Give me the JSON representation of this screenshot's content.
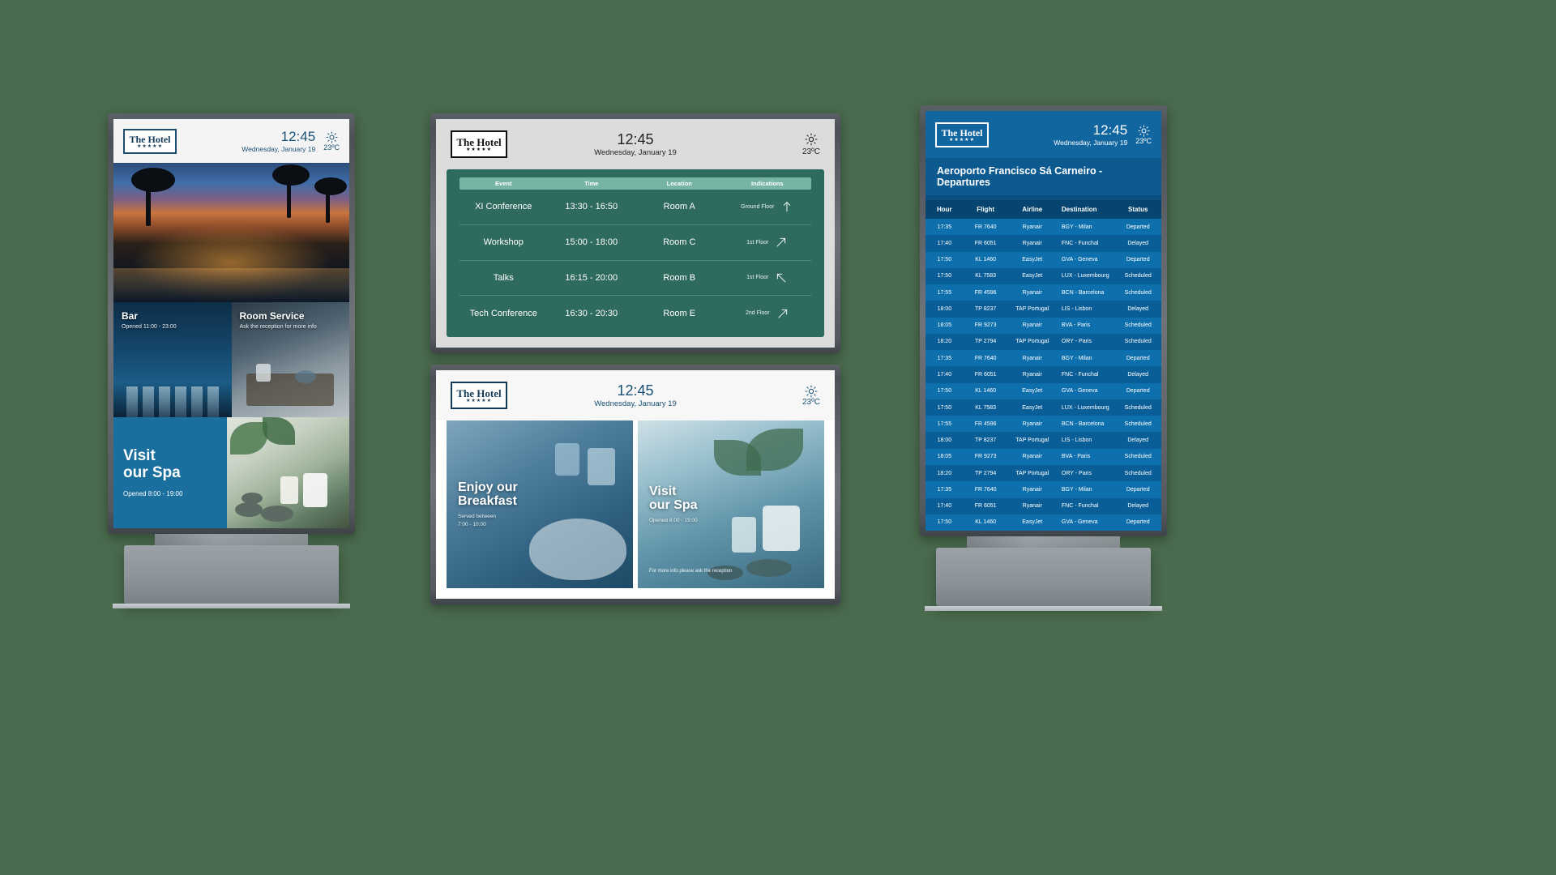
{
  "brand": {
    "name": "The Hotel",
    "stars": "★★★★★"
  },
  "clock": {
    "time": "12:45",
    "date": "Wednesday, January 19",
    "weather_icon": "sun-icon",
    "temperature": "23ºC"
  },
  "colors": {
    "hotel_navy": "#123a57",
    "conference_green": "#2f6a5e",
    "conference_header_green": "#78b4a4",
    "departures_blue": "#0e6fad",
    "departures_header_blue": "#06456f",
    "spa_blue": "#1a6f9e",
    "background_green": "#4a6b4d"
  },
  "display1": {
    "name": "Hotel portrait kiosk",
    "hero": {
      "alt": "tropical resort pool at sunset"
    },
    "tiles": [
      {
        "title": "Bar",
        "subtitle": "Opened 11:00 - 23:00"
      },
      {
        "title": "Room Service",
        "subtitle": "Ask the reception for more info"
      }
    ],
    "spa": {
      "title_line1": "Visit",
      "title_line2": "our Spa",
      "subtitle": "Opened 8:00 - 19:00"
    }
  },
  "display2": {
    "name": "Conference schedule",
    "table": {
      "columns": [
        "Event",
        "Time",
        "Location",
        "Indications"
      ],
      "rows": [
        {
          "event": "XI Conference",
          "time": "13:30 - 16:50",
          "location": "Room A",
          "floor": "Ground Floor",
          "arrow": "arrow-up"
        },
        {
          "event": "Workshop",
          "time": "15:00 - 18:00",
          "location": "Room C",
          "floor": "1st Floor",
          "arrow": "arrow-up-right"
        },
        {
          "event": "Talks",
          "time": "16:15 - 20:00",
          "location": "Room B",
          "floor": "1st Floor",
          "arrow": "arrow-up-left"
        },
        {
          "event": "Tech Conference",
          "time": "16:30 - 20:30",
          "location": "Room E",
          "floor": "2nd Floor",
          "arrow": "arrow-up-right"
        }
      ]
    }
  },
  "display3": {
    "name": "Promotions board",
    "promos": [
      {
        "title_line1": "Enjoy our",
        "title_line2": "Breakfast",
        "subtitle_line1": "Served between",
        "subtitle_line2": "7:00 - 10:00",
        "footer": ""
      },
      {
        "title_line1": "Visit",
        "title_line2": "our Spa",
        "subtitle_line1": "Opened 8:00 - 19:00",
        "subtitle_line2": "",
        "footer": "For more info please ask the reception"
      }
    ]
  },
  "display4": {
    "name": "Airport departures board",
    "board_title": "Aeroporto Francisco Sá Carneiro - Departures",
    "columns": [
      "Hour",
      "Flight",
      "Airline",
      "Destination",
      "Status"
    ],
    "rows": [
      {
        "hour": "17:35",
        "flight": "FR 7640",
        "airline": "Ryanair",
        "destination": "BGY - Milan",
        "status": "Departed"
      },
      {
        "hour": "17:40",
        "flight": "FR 6051",
        "airline": "Ryanair",
        "destination": "FNC - Funchal",
        "status": "Delayed"
      },
      {
        "hour": "17:50",
        "flight": "KL 1460",
        "airline": "EasyJet",
        "destination": "GVA - Geneva",
        "status": "Departed"
      },
      {
        "hour": "17:50",
        "flight": "KL 7583",
        "airline": "EasyJet",
        "destination": "LUX - Luxembourg",
        "status": "Scheduled"
      },
      {
        "hour": "17:55",
        "flight": "FR 4596",
        "airline": "Ryanair",
        "destination": "BCN - Barcelona",
        "status": "Scheduled"
      },
      {
        "hour": "18:00",
        "flight": "TP 8237",
        "airline": "TAP Portugal",
        "destination": "LIS - Lisbon",
        "status": "Delayed"
      },
      {
        "hour": "18:05",
        "flight": "FR 9273",
        "airline": "Ryanair",
        "destination": "BVA - Paris",
        "status": "Scheduled"
      },
      {
        "hour": "18:20",
        "flight": "TP 2794",
        "airline": "TAP Portugal",
        "destination": "ORY - Paris",
        "status": "Scheduled"
      },
      {
        "hour": "17:35",
        "flight": "FR 7640",
        "airline": "Ryanair",
        "destination": "BGY - Milan",
        "status": "Departed"
      },
      {
        "hour": "17:40",
        "flight": "FR 6051",
        "airline": "Ryanair",
        "destination": "FNC - Funchal",
        "status": "Delayed"
      },
      {
        "hour": "17:50",
        "flight": "KL 1460",
        "airline": "EasyJet",
        "destination": "GVA - Geneva",
        "status": "Departed"
      },
      {
        "hour": "17:50",
        "flight": "KL 7583",
        "airline": "EasyJet",
        "destination": "LUX - Luxembourg",
        "status": "Scheduled"
      },
      {
        "hour": "17:55",
        "flight": "FR 4596",
        "airline": "Ryanair",
        "destination": "BCN - Barcelona",
        "status": "Scheduled"
      },
      {
        "hour": "18:00",
        "flight": "TP 8237",
        "airline": "TAP Portugal",
        "destination": "LIS - Lisbon",
        "status": "Delayed"
      },
      {
        "hour": "18:05",
        "flight": "FR 9273",
        "airline": "Ryanair",
        "destination": "BVA - Paris",
        "status": "Scheduled"
      },
      {
        "hour": "18:20",
        "flight": "TP 2794",
        "airline": "TAP Portugal",
        "destination": "ORY - Paris",
        "status": "Scheduled"
      },
      {
        "hour": "17:35",
        "flight": "FR 7640",
        "airline": "Ryanair",
        "destination": "BGY - Milan",
        "status": "Departed"
      },
      {
        "hour": "17:40",
        "flight": "FR 6051",
        "airline": "Ryanair",
        "destination": "FNC - Funchal",
        "status": "Delayed"
      },
      {
        "hour": "17:50",
        "flight": "KL 1460",
        "airline": "EasyJet",
        "destination": "GVA - Geneva",
        "status": "Departed"
      }
    ]
  }
}
